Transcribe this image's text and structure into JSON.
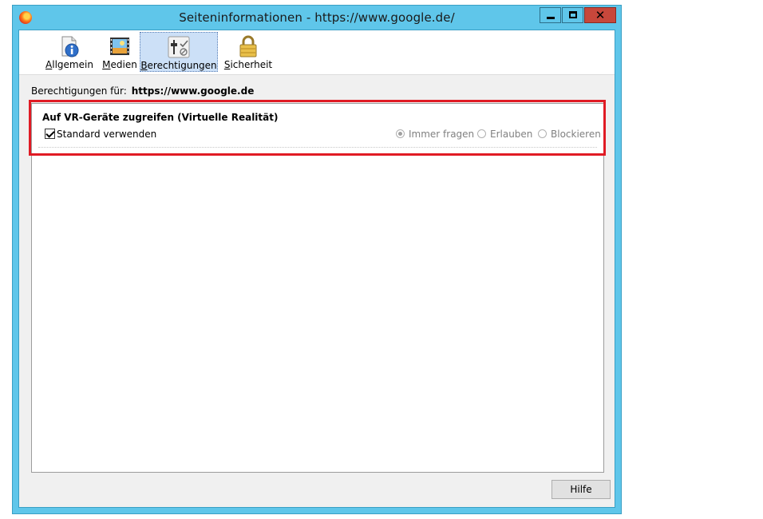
{
  "window": {
    "title": "Seiteninformationen - https://www.google.de/",
    "controls": {
      "minimize_icon": "minimize-icon",
      "maximize_icon": "maximize-icon",
      "close_glyph": "✕"
    }
  },
  "toolbar": {
    "tabs": [
      {
        "label": "Allgemein",
        "icon": "info-icon",
        "active": false
      },
      {
        "label": "Medien",
        "icon": "media-icon",
        "active": false
      },
      {
        "label": "Berechtigungen",
        "icon": "permissions-icon",
        "active": true
      },
      {
        "label": "Sicherheit",
        "icon": "lock-icon",
        "active": false
      }
    ]
  },
  "permissions": {
    "for_label": "Berechtigungen für:",
    "for_url": "https://www.google.de",
    "item": {
      "title": "Auf VR-Geräte zugreifen (Virtuelle Realität)",
      "use_default_label": "Standard verwenden",
      "use_default_checked": true,
      "options": [
        {
          "label": "Immer fragen",
          "selected": true
        },
        {
          "label": "Erlauben",
          "selected": false
        },
        {
          "label": "Blockieren",
          "selected": false
        }
      ]
    }
  },
  "footer": {
    "help_label": "Hilfe"
  },
  "colors": {
    "titlebar": "#5fc6ea",
    "close_button": "#c7473b",
    "highlight": "#e01b24",
    "active_tab": "#cce0f7"
  }
}
